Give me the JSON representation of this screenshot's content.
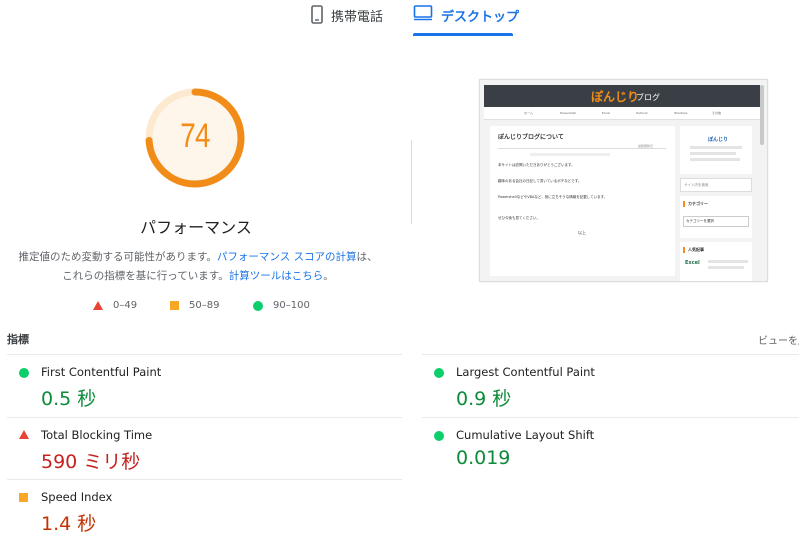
{
  "tabs": [
    {
      "label": "携帯電話",
      "icon": "smartphone-icon",
      "active": false
    },
    {
      "label": "デスクトップ",
      "icon": "desktop-icon",
      "active": true
    }
  ],
  "performance": {
    "score": "74",
    "score_fraction": 0.74,
    "title": "パフォーマンス",
    "description_prefix": "推定値のため変動する可能性があります。",
    "link_score_calc": "パフォーマンス スコアの計算",
    "description_middle": "は、これらの指標を基に行っています。",
    "link_calculator": "計算ツールはこちら",
    "description_suffix": "。"
  },
  "legend": [
    {
      "shape": "triangle",
      "range": "0–49",
      "color": "#ea4335"
    },
    {
      "shape": "square",
      "range": "50–89",
      "color": "#f9a825"
    },
    {
      "shape": "circle",
      "range": "90–100",
      "color": "#0cce6b"
    }
  ],
  "thumbnail": {
    "site_logo_main": "ぽんじり",
    "site_logo_sub": "ブログ",
    "nav": [
      "ホーム",
      "Powershell",
      "Excel",
      "Outlook",
      "Windows",
      "その他"
    ],
    "post_title": "ぽんじりブログについて",
    "post_date": "最終更新日",
    "post_lines": [
      "本サイトは訪問いただきありがとうございます。",
      "趣味のある会社の日記して書いているボチなどです。",
      "PowershellなどやVBAなど、役に立ちそうな情報を記載しています。",
      "ぜひ今後も見てください。"
    ],
    "post_footer": "以上",
    "profile_name": "ぽんじり",
    "search_placeholder": "サイト内を検索",
    "category_heading": "カテゴリー",
    "category_select": "カテゴリーを選択",
    "popular_heading": "人気記事",
    "popular_label": "Excel"
  },
  "metrics": {
    "heading": "指標",
    "view_toggle": "ビューを展",
    "items": [
      {
        "name": "First Contentful Paint",
        "value": "0.5 秒",
        "rating": "good"
      },
      {
        "name": "Largest Contentful Paint",
        "value": "0.9 秒",
        "rating": "good"
      },
      {
        "name": "Total Blocking Time",
        "value": "590 ミリ秒",
        "rating": "poor"
      },
      {
        "name": "Cumulative Layout Shift",
        "value": "0.019",
        "rating": "good"
      },
      {
        "name": "Speed Index",
        "value": "1.4 秒",
        "rating": "average"
      }
    ]
  },
  "colors": {
    "accent": "#1a73e8",
    "gauge_average": "#f28c18",
    "good": "#0cce6b",
    "average": "#f9a825",
    "poor": "#ea4335"
  }
}
